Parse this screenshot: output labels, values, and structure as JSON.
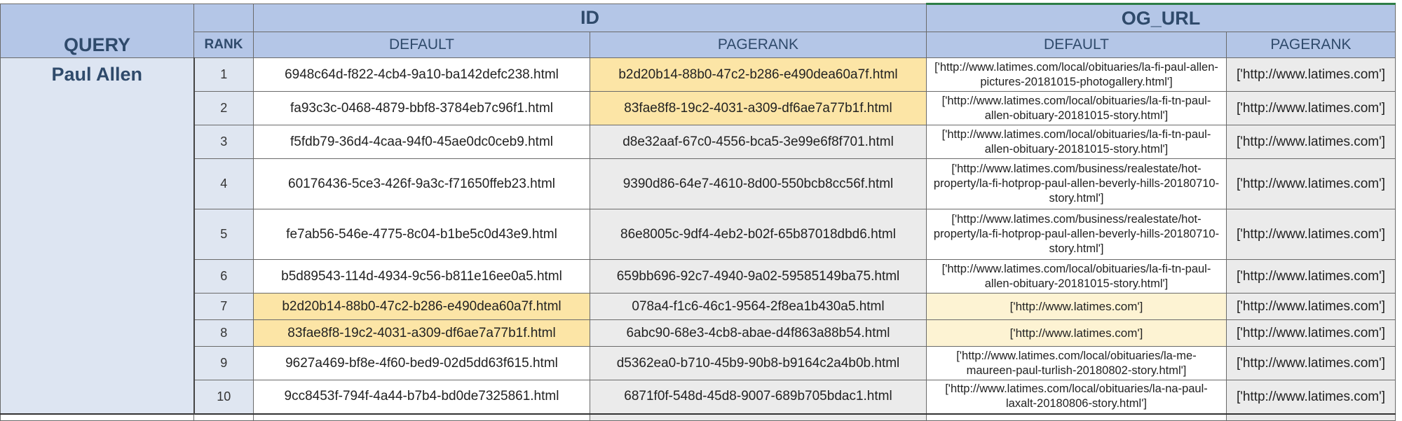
{
  "headers": {
    "query": "QUERY",
    "rank": "RANK",
    "id_group": "ID",
    "og_group": "OG_URL",
    "default": "DEFAULT",
    "pagerank": "PAGERANK"
  },
  "query": "Paul Allen",
  "colors": {
    "header": "#b4c6e7",
    "highlight": "#fce5a6",
    "highlight_soft": "#fdf3d3",
    "alt_column": "#ebebeb"
  },
  "rows": [
    {
      "rank": "1",
      "id_default": "6948c64d-f822-4cb4-9a10-ba142defc238.html",
      "id_pagerank": "b2d20b14-88b0-47c2-b286-e490dea60a7f.html",
      "url_default": "['http://www.latimes.com/local/obituaries/la-fi-paul-allen-pictures-20181015-photogallery.html']",
      "url_pagerank": "['http://www.latimes.com']"
    },
    {
      "rank": "2",
      "id_default": "fa93c3c-0468-4879-bbf8-3784eb7c96f1.html",
      "id_pagerank": "83fae8f8-19c2-4031-a309-df6ae7a77b1f.html",
      "url_default": "['http://www.latimes.com/local/obituaries/la-fi-tn-paul-allen-obituary-20181015-story.html']",
      "url_pagerank": "['http://www.latimes.com']"
    },
    {
      "rank": "3",
      "id_default": "f5fdb79-36d4-4caa-94f0-45ae0dc0ceb9.html",
      "id_pagerank": "d8e32aaf-67c0-4556-bca5-3e99e6f8f701.html",
      "url_default": "['http://www.latimes.com/local/obituaries/la-fi-tn-paul-allen-obituary-20181015-story.html']",
      "url_pagerank": "['http://www.latimes.com']"
    },
    {
      "rank": "4",
      "id_default": "60176436-5ce3-426f-9a3c-f71650ffeb23.html",
      "id_pagerank": "9390d86-64e7-4610-8d00-550bcb8cc56f.html",
      "url_default": "['http://www.latimes.com/business/realestate/hot-property/la-fi-hotprop-paul-allen-beverly-hills-20180710-story.html']",
      "url_pagerank": "['http://www.latimes.com']"
    },
    {
      "rank": "5",
      "id_default": "fe7ab56-546e-4775-8c04-b1be5c0d43e9.html",
      "id_pagerank": "86e8005c-9df4-4eb2-b02f-65b87018dbd6.html",
      "url_default": "['http://www.latimes.com/business/realestate/hot-property/la-fi-hotprop-paul-allen-beverly-hills-20180710-story.html']",
      "url_pagerank": "['http://www.latimes.com']"
    },
    {
      "rank": "6",
      "id_default": "b5d89543-114d-4934-9c56-b811e16ee0a5.html",
      "id_pagerank": "659bb696-92c7-4940-9a02-59585149ba75.html",
      "url_default": "['http://www.latimes.com/local/obituaries/la-fi-tn-paul-allen-obituary-20181015-story.html']",
      "url_pagerank": "['http://www.latimes.com']"
    },
    {
      "rank": "7",
      "id_default": "b2d20b14-88b0-47c2-b286-e490dea60a7f.html",
      "id_pagerank": "078a4-f1c6-46c1-9564-2f8ea1b430a5.html",
      "url_default": "['http://www.latimes.com']",
      "url_pagerank": "['http://www.latimes.com']"
    },
    {
      "rank": "8",
      "id_default": "83fae8f8-19c2-4031-a309-df6ae7a77b1f.html",
      "id_pagerank": "6abc90-68e3-4cb8-abae-d4f863a88b54.html",
      "url_default": "['http://www.latimes.com']",
      "url_pagerank": "['http://www.latimes.com']"
    },
    {
      "rank": "9",
      "id_default": "9627a469-bf8e-4f60-bed9-02d5dd63f615.html",
      "id_pagerank": "d5362ea0-b710-45b9-90b8-b9164c2a4b0b.html",
      "url_default": "['http://www.latimes.com/local/obituaries/la-me-maureen-paul-turlish-20180802-story.html']",
      "url_pagerank": "['http://www.latimes.com']"
    },
    {
      "rank": "10",
      "id_default": "9cc8453f-794f-4a44-b7b4-bd0de7325861.html",
      "id_pagerank": "6871f0f-548d-45d8-9007-689b705bdac1.html",
      "url_default": "['http://www.latimes.com/local/obituaries/la-na-paul-laxalt-20180806-story.html']",
      "url_pagerank": "['http://www.latimes.com']"
    }
  ]
}
